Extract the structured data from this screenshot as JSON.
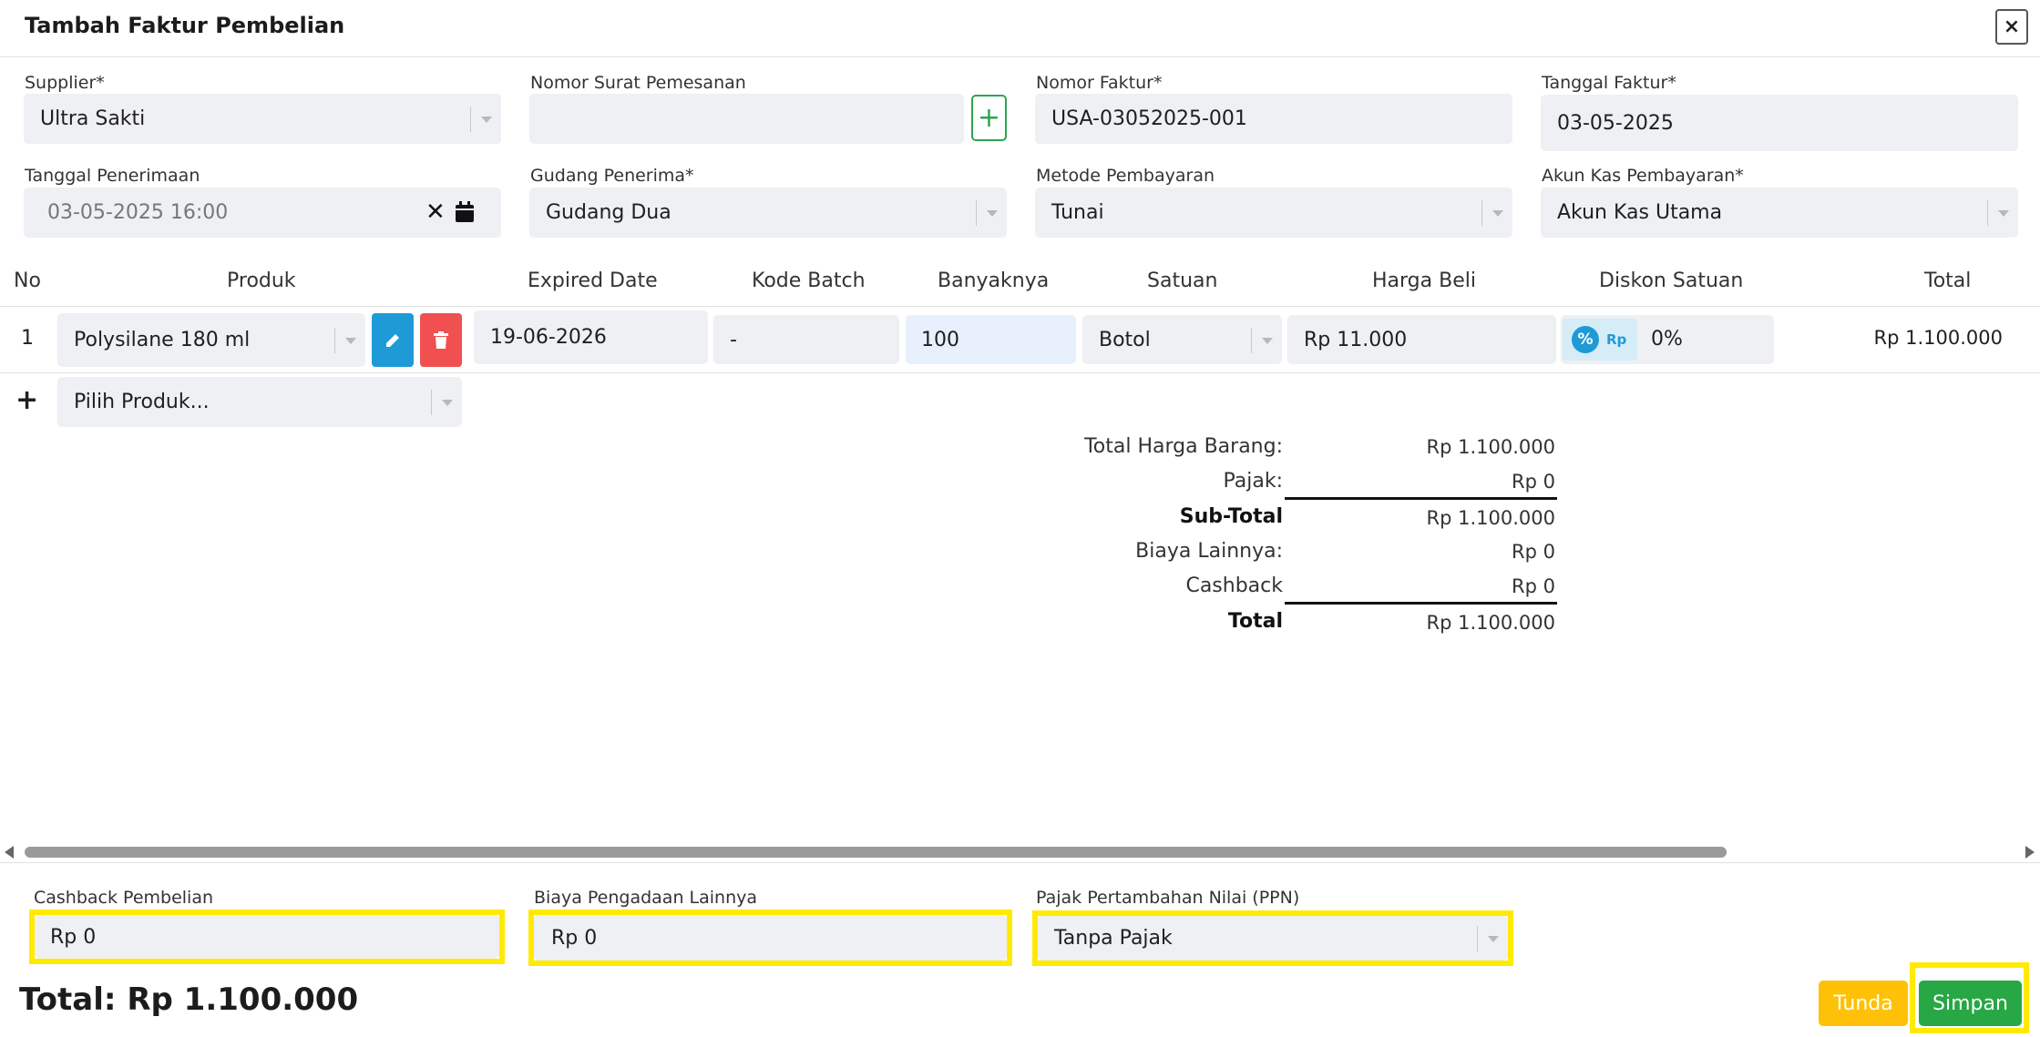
{
  "header": {
    "title": "Tambah Faktur Pembelian",
    "close_label": "×"
  },
  "form": {
    "supplier": {
      "label": "Supplier*",
      "value": "Ultra Sakti"
    },
    "nomor_surat": {
      "label": "Nomor Surat Pemesanan",
      "value": "",
      "add_label": "+"
    },
    "nomor_faktur": {
      "label": "Nomor Faktur*",
      "value": "USA-03052025-001"
    },
    "tanggal_faktur": {
      "label": "Tanggal Faktur*",
      "value": "03-05-2025"
    },
    "tanggal_penerimaan": {
      "label": "Tanggal Penerimaan",
      "value": "03-05-2025 16:00"
    },
    "gudang": {
      "label": "Gudang Penerima*",
      "value": "Gudang Dua"
    },
    "metode": {
      "label": "Metode Pembayaran",
      "value": "Tunai"
    },
    "akun_kas": {
      "label": "Akun Kas Pembayaran*",
      "value": "Akun Kas Utama"
    }
  },
  "table": {
    "headers": [
      "No",
      "Produk",
      "Expired Date",
      "Kode Batch",
      "Banyaknya",
      "Satuan",
      "Harga Beli",
      "Diskon Satuan",
      "Total"
    ],
    "rows": [
      {
        "no": "1",
        "produk": "Polysilane 180 ml",
        "expired": "19-06-2026",
        "batch": "-",
        "qty": "100",
        "satuan": "Botol",
        "harga": "Rp 11.000",
        "diskon_rp": "Rp",
        "diskon": "0%",
        "total": "Rp 1.100.000"
      }
    ],
    "add_row": {
      "plus": "+",
      "placeholder": "Pilih Produk..."
    }
  },
  "summary": {
    "total_harga_label": "Total Harga Barang:",
    "total_harga": "Rp 1.100.000",
    "pajak_label": "Pajak:",
    "pajak": "Rp 0",
    "subtotal_label": "Sub-Total",
    "subtotal": "Rp 1.100.000",
    "biaya_label": "Biaya Lainnya:",
    "biaya": "Rp 0",
    "cashback_label": "Cashback",
    "cashback": "Rp 0",
    "total_label": "Total",
    "total": "Rp 1.100.000"
  },
  "footer": {
    "cashback": {
      "label": "Cashback Pembelian",
      "value": "Rp 0"
    },
    "biaya": {
      "label": "Biaya Pengadaan Lainnya",
      "value": "Rp 0"
    },
    "ppn": {
      "label": "Pajak Pertambahan Nilai (PPN)",
      "value": "Tanpa Pajak"
    },
    "grand_total": "Total: Rp 1.100.000",
    "tunda_label": "Tunda",
    "simpan_label": "Simpan"
  },
  "colors": {
    "highlight": "#ffea00",
    "edit": "#1e9bd7",
    "delete": "#f05050",
    "success": "#28a745",
    "warning": "#ffc107"
  }
}
